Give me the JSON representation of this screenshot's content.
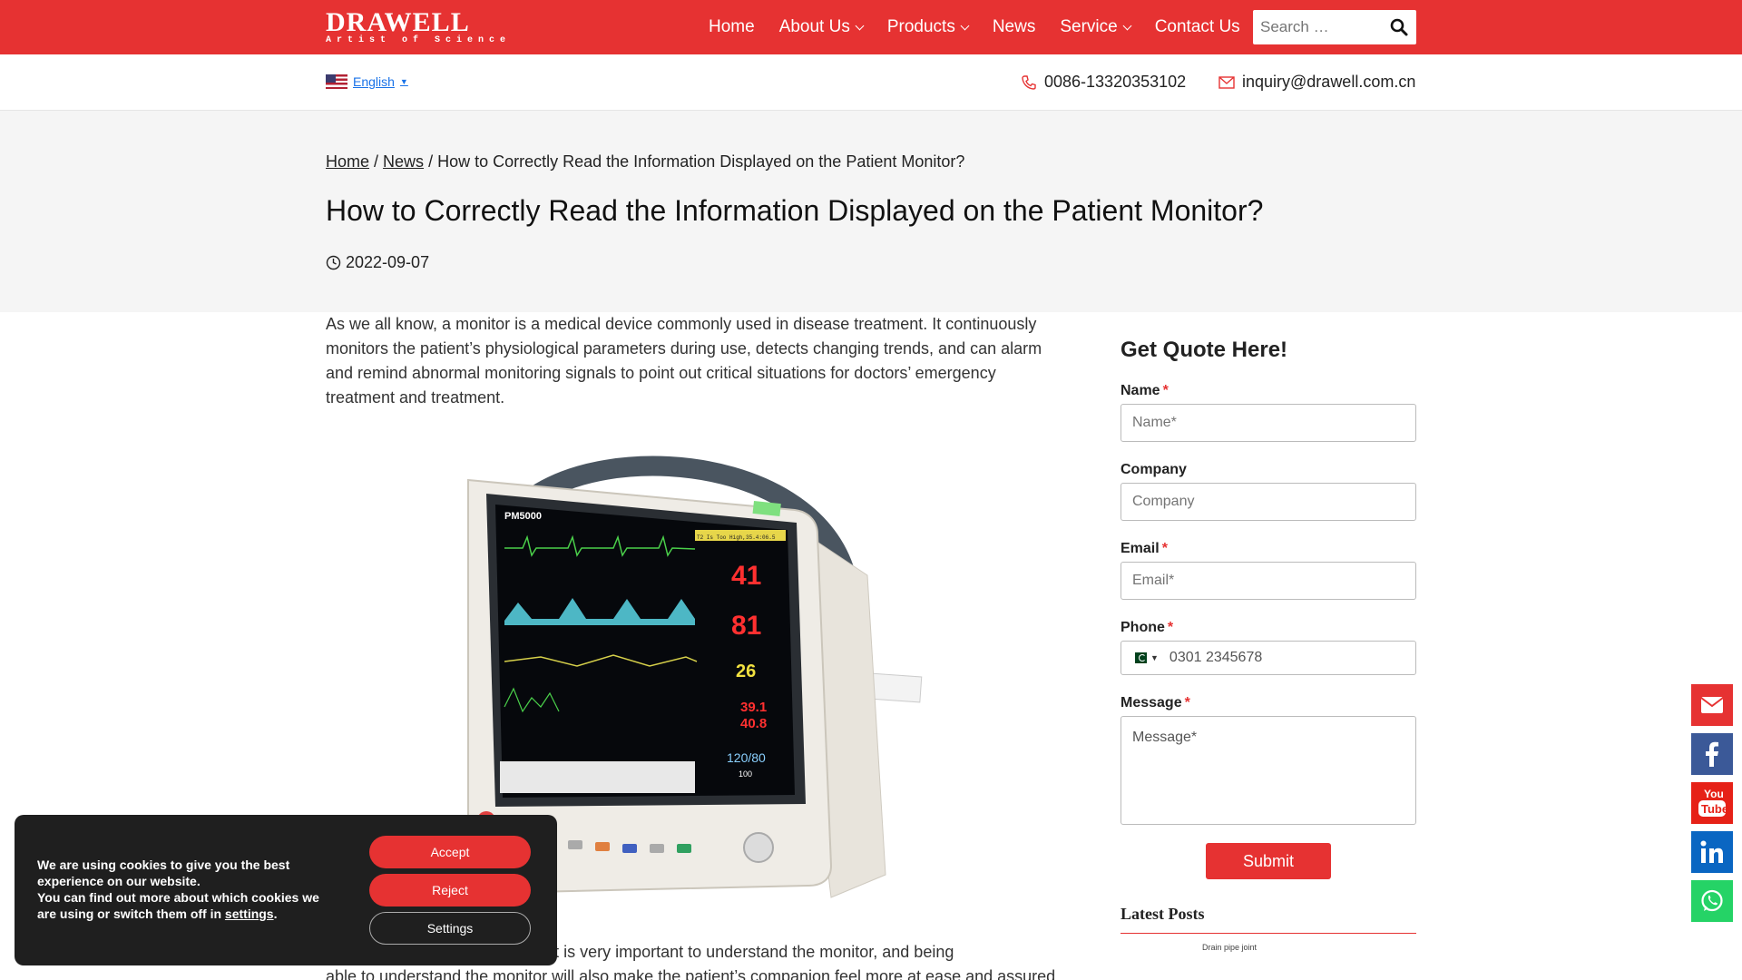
{
  "header": {
    "logo_main": "DRAWELL",
    "logo_sub": "Artist of Science",
    "nav": [
      {
        "label": "Home",
        "has_dropdown": false
      },
      {
        "label": "About Us",
        "has_dropdown": true
      },
      {
        "label": "Products",
        "has_dropdown": true
      },
      {
        "label": "News",
        "has_dropdown": false
      },
      {
        "label": "Service",
        "has_dropdown": true
      },
      {
        "label": "Contact Us",
        "has_dropdown": false
      }
    ],
    "search_placeholder": "Search …",
    "search_icon": "search-icon"
  },
  "subbar": {
    "language": "English",
    "phone": "0086-13320353102",
    "email": "inquiry@drawell.com.cn"
  },
  "article": {
    "breadcrumb": {
      "home": "Home",
      "news": "News",
      "current": "How to Correctly Read the Information Displayed on the Patient Monitor?"
    },
    "title": "How to Correctly Read the Information Displayed on the Patient Monitor?",
    "date": "2022-09-07",
    "intro": "As we all know, a monitor is a medical device commonly used in disease treatment. It continuously monitors the patient’s physiological parameters during use, detects changing trends, and can alarm and remind abnormal monitoring signals to point out critical situations for doctors’ emergency treatment and treatment.",
    "para2_line1": "As a patient or family member, it is very important to understand the monitor, and being",
    "para2_line2": "able to understand the monitor will also make the patient’s companion feel more at ease and assured",
    "monitor": {
      "model": "PM5000",
      "alarm_text": "T2 Is Too High,35.4:06.5",
      "values": {
        "spo2_a": "41",
        "spo2_b": "81",
        "resp": "26",
        "temp1": "39.1",
        "temp2": "40.8",
        "nibp": "120/80",
        "map": "100"
      }
    }
  },
  "sidebar": {
    "quote_title": "Get Quote Here!",
    "fields": {
      "name_label": "Name",
      "name_placeholder": "Name*",
      "company_label": "Company",
      "company_placeholder": "Company",
      "email_label": "Email",
      "email_placeholder": "Email*",
      "phone_label": "Phone",
      "phone_placeholder": "0301 2345678",
      "message_label": "Message",
      "message_placeholder": "Message*"
    },
    "required_mark": "*",
    "submit_label": "Submit",
    "latest_posts_title": "Latest Posts",
    "latest_thumb_caption": "Drain pipe joint"
  },
  "floating_social": [
    "email-icon",
    "facebook-icon",
    "youtube-icon",
    "linkedin-icon",
    "whatsapp-icon"
  ],
  "cookie": {
    "line1": "We are using cookies to give you the best experience on our website.",
    "line2_pre": "You can find out more about which cookies we are using or switch them off in ",
    "line2_link": "settings",
    "line2_post": ".",
    "accept": "Accept",
    "reject": "Reject",
    "settings": "Settings"
  },
  "colors": {
    "brand_red": "#e63232",
    "hero_bg": "#f5f5f5",
    "cookie_bg": "#1f1f1f",
    "facebook": "#3b5998",
    "youtube": "#e62117",
    "linkedin": "#0a66c2",
    "whatsapp": "#25d366"
  }
}
